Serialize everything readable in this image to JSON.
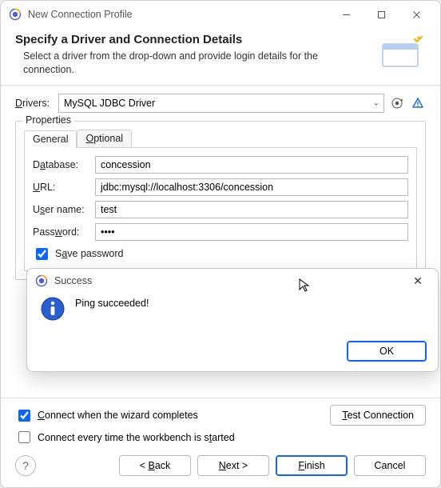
{
  "window": {
    "title": "New Connection Profile"
  },
  "header": {
    "heading": "Specify a Driver and Connection Details",
    "desc": "Select a driver from the drop-down and provide login details for the connection."
  },
  "drivers": {
    "label": "Drivers:",
    "selected": "MySQL JDBC Driver"
  },
  "properties": {
    "legend": "Properties",
    "tabs": {
      "general": "General",
      "optional": "Optional"
    },
    "fields": {
      "database": {
        "label_pre": "D",
        "label_ul": "a",
        "label_post": "tabase:",
        "value": "concession"
      },
      "url": {
        "label_ul": "U",
        "label_post": "RL:",
        "value": "jdbc:mysql://localhost:3306/concession"
      },
      "user": {
        "label_pre": "U",
        "label_ul": "s",
        "label_post": "er name:",
        "value": "test"
      },
      "password": {
        "label_pre": "Pass",
        "label_ul": "w",
        "label_post": "ord:",
        "value": "••••"
      },
      "save_pw": {
        "label_pre": "S",
        "label_ul": "a",
        "label_post": "ve password",
        "checked": true
      }
    }
  },
  "options": {
    "connect_complete": {
      "label_ul": "C",
      "label_post": "onnect when the wizard completes",
      "checked": true
    },
    "connect_start": {
      "label_pre": "Connect every time the workbench is s",
      "label_ul": "t",
      "label_post": "arted",
      "checked": false
    },
    "test_btn": {
      "label_ul": "T",
      "label_post": "est Connection"
    }
  },
  "nav": {
    "back": "< Back",
    "next": "Next >",
    "finish": "Finish",
    "cancel": "Cancel"
  },
  "modal": {
    "title": "Success",
    "message": "Ping succeeded!",
    "ok": "OK"
  }
}
